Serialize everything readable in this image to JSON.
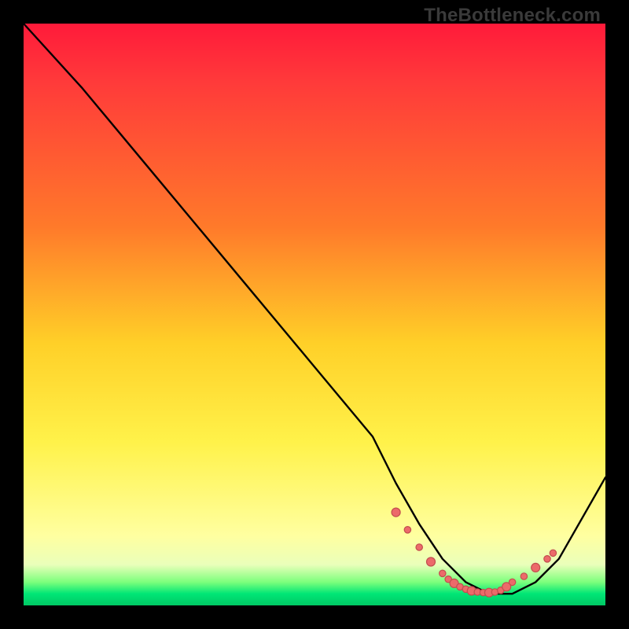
{
  "watermark": "TheBottleneck.com",
  "chart_data": {
    "type": "line",
    "title": "",
    "xlabel": "",
    "ylabel": "",
    "xlim": [
      0,
      100
    ],
    "ylim": [
      0,
      100
    ],
    "grid": false,
    "legend": false,
    "series": [
      {
        "name": "curve",
        "x": [
          0,
          10,
          20,
          30,
          40,
          50,
          60,
          64,
          68,
          72,
          76,
          80,
          84,
          88,
          92,
          100
        ],
        "y": [
          100,
          89,
          77,
          65,
          53,
          41,
          29,
          21,
          14,
          8,
          4,
          2,
          2,
          4,
          8,
          22
        ]
      }
    ],
    "markers": {
      "name": "dotted-band",
      "x": [
        64,
        66,
        68,
        70,
        72,
        73,
        74,
        75,
        76,
        77,
        78,
        79,
        80,
        81,
        82,
        83,
        84,
        86,
        88,
        90,
        91
      ],
      "y": [
        16,
        13,
        10,
        7.5,
        5.5,
        4.5,
        3.8,
        3.2,
        2.8,
        2.5,
        2.3,
        2.2,
        2.2,
        2.3,
        2.6,
        3.2,
        4.0,
        5.0,
        6.5,
        8.0,
        9.0
      ]
    },
    "colors": {
      "gradient_top": "#ff1a3a",
      "gradient_mid": "#ffd028",
      "gradient_bottom": "#00c864",
      "curve": "#000000",
      "marker_fill": "#ec6a6a",
      "marker_stroke": "#c24e4e"
    }
  }
}
